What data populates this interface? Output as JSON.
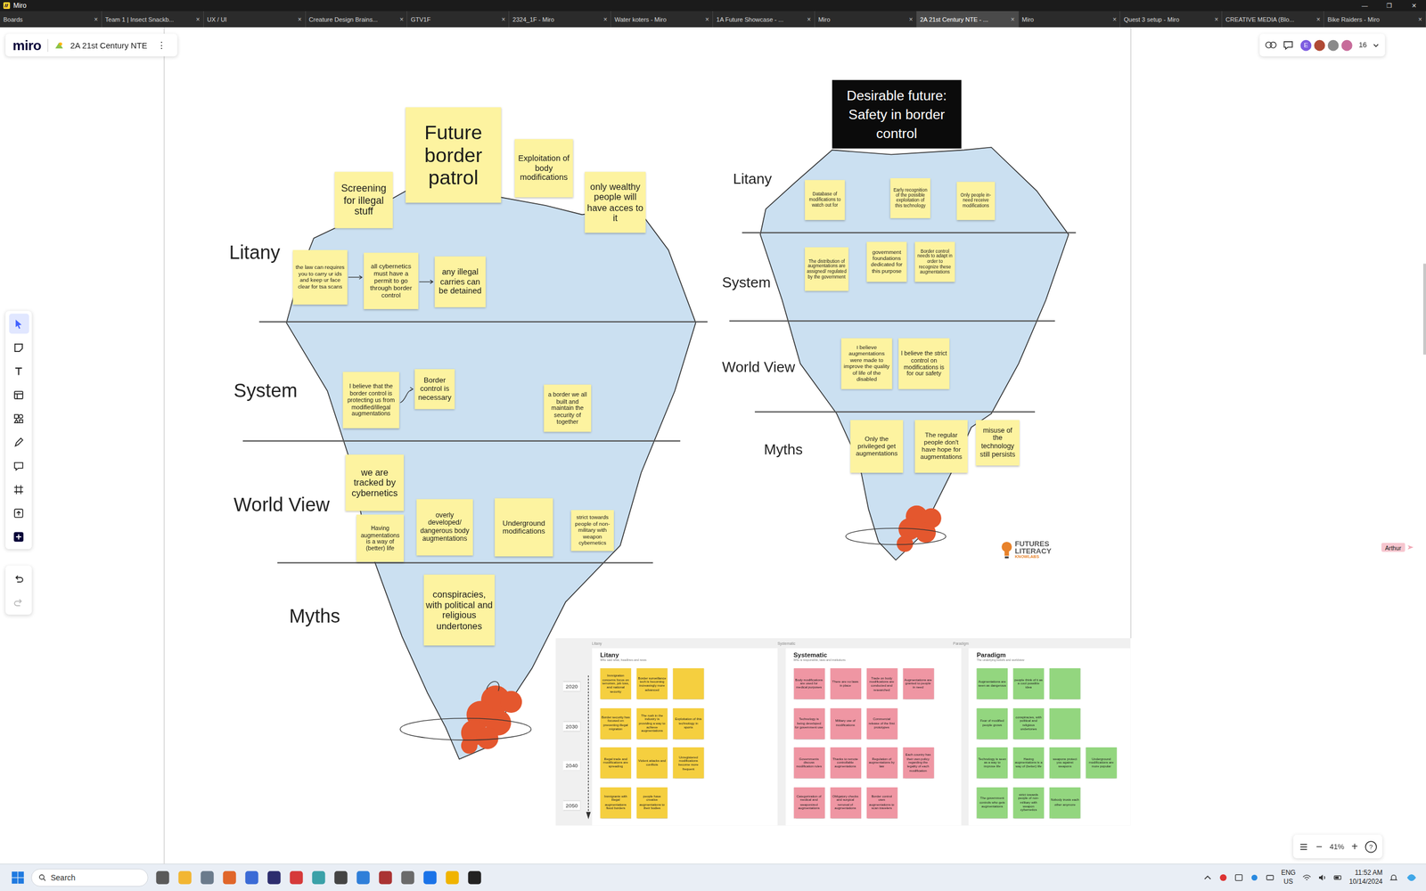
{
  "window": {
    "title": "Miro",
    "controls": [
      "—",
      "❐",
      "✕"
    ]
  },
  "tabs": [
    {
      "label": "Boards",
      "selected": false
    },
    {
      "label": "Team 1 | Insect Snackb...",
      "selected": false
    },
    {
      "label": "UX / UI",
      "selected": false
    },
    {
      "label": "Creature Design Brains...",
      "selected": false
    },
    {
      "label": "GTV1F",
      "selected": false
    },
    {
      "label": "2324_1F - Miro",
      "selected": false
    },
    {
      "label": "Water koters - Miro",
      "selected": false
    },
    {
      "label": "1A Future Showcase - ...",
      "selected": false
    },
    {
      "label": "Miro",
      "selected": false
    },
    {
      "label": "2A 21st Century NTE - ...",
      "selected": true
    },
    {
      "label": "Miro",
      "selected": false
    },
    {
      "label": "Quest 3 setup - Miro",
      "selected": false
    },
    {
      "label": "CREATIVE MEDIA (Blo...",
      "selected": false
    },
    {
      "label": "Bike Raiders - Miro",
      "selected": false
    }
  ],
  "tab_close": "×",
  "board": {
    "logo": "miro",
    "name": "2A 21st Century NTE",
    "menu": "⋮",
    "collaborator_count": "16",
    "avatars": [
      {
        "initial": "E",
        "color": "#7c5ce0"
      },
      {
        "initial": "",
        "color": "#b04a35"
      },
      {
        "initial": "",
        "color": "#8a8a8a"
      },
      {
        "initial": "",
        "color": "#c76b9a"
      }
    ]
  },
  "toolbar": {
    "tools": [
      {
        "kind": "select",
        "selected": true
      },
      {
        "kind": "sticky",
        "selected": false
      },
      {
        "kind": "text",
        "selected": false
      },
      {
        "kind": "table",
        "selected": false
      },
      {
        "kind": "shapes",
        "selected": false
      },
      {
        "kind": "pen",
        "selected": false
      },
      {
        "kind": "comment",
        "selected": false
      },
      {
        "kind": "frame",
        "selected": false
      },
      {
        "kind": "upload",
        "selected": false
      },
      {
        "kind": "more",
        "selected": false
      }
    ],
    "history": [
      {
        "kind": "undo",
        "disabled": false
      },
      {
        "kind": "redo",
        "disabled": true
      }
    ]
  },
  "zoom": {
    "level": "41%",
    "minus": "−",
    "plus": "+",
    "help": "?"
  },
  "cursor_label": "Arthur",
  "left_iceberg": {
    "layers": [
      "Litany",
      "System",
      "World View",
      "Myths"
    ],
    "notes": [
      {
        "text": "Future border patrol"
      },
      {
        "text": "Screening for illegal stuff"
      },
      {
        "text": "Exploitation of body modifications"
      },
      {
        "text": "only wealthy people will have acces to it"
      },
      {
        "text": "the law can requires you to carry ur ids and keep ur face clear for tsa scans"
      },
      {
        "text": "all cybernetics must have a permit to go through border control"
      },
      {
        "text": "any illegal carries can be detained"
      },
      {
        "text": "I believe that the border control is protecting us from modified/illegal augmentations"
      },
      {
        "text": "Border control is necessary"
      },
      {
        "text": "a border we all built and maintain the security of together"
      },
      {
        "text": "we are tracked by cybernetics"
      },
      {
        "text": "Having augmentations is a way of (better) life"
      },
      {
        "text": "overly developed/ dangerous body augmentations"
      },
      {
        "text": "Underground modifications"
      },
      {
        "text": "strict towards people of non-military with weapon cybernetics"
      },
      {
        "text": "conspiracies, with political and religious undertones"
      }
    ]
  },
  "right_iceberg": {
    "title": "Desirable future: Safety in border control",
    "layers": [
      "Litany",
      "System",
      "World View",
      "Myths"
    ],
    "notes": [
      {
        "text": "Database of modifications to watch out for"
      },
      {
        "text": "Early recognition of the possible exploitation of this technology"
      },
      {
        "text": "Only people in-need receive modifications"
      },
      {
        "text": "The distribution of augmentations are assigned/ regulated by the government"
      },
      {
        "text": "government foundations dedicated for this purpose"
      },
      {
        "text": "Border control needs to adapt in order to recognize these augmentations"
      },
      {
        "text": "I believe augmentations were made to improve the quality of life of the disabled"
      },
      {
        "text": "I believe the strict control on modifications is for our safety"
      },
      {
        "text": "Only the privileged get augmentations"
      },
      {
        "text": "The regular people don't have hope for augmentations"
      },
      {
        "text": "misuse of the technology still persists"
      }
    ]
  },
  "logo": {
    "line1": "FUTURES",
    "line2": "LITERACY",
    "line3": "KNOWLABS"
  },
  "timeline_table": {
    "years": [
      "2020",
      "2030",
      "2040",
      "2050"
    ],
    "panels": [
      {
        "label": "Litany",
        "title": "Litany",
        "subtitle": "Who said what, headlines and news",
        "color": "#f5cf3f",
        "rows": [
          [
            "Immigration concerns focus on terrorism, job loss, and national security",
            "Border surveillance tech is becoming increasingly more advanced",
            ""
          ],
          [
            "Border security has focused on preventing illegal migration",
            "The rush in the industry is providing a way to achieve augmentations",
            "Exploitation of this technology in sports"
          ],
          [
            "Illegal trade and modifications are spreading",
            "Violent attacks and conflicts",
            "Unregistered modifications become more frequent"
          ],
          [
            "Immigrants with illegal augmentations flood borders",
            "people have creative augmentations to their bodies"
          ]
        ]
      },
      {
        "label": "Systematic",
        "title": "Systematic",
        "subtitle": "Who is responsible, laws and institutions",
        "color": "#ef96a3",
        "rows": [
          [
            "Body modifications are used for medical purposes",
            "There are no laws in place",
            "Trade on body modifications are conducted and researched",
            "Augmentations are granted to people in need"
          ],
          [
            "Technology is being developed for government use",
            "Military use of modifications",
            "Commercial release of the first prototypes"
          ],
          [
            "Governments discuss modification rules",
            "Thanks to remote controllable augmentations",
            "Regulation of augmentations by law",
            "Each country has their own policy regarding the legality of each modification"
          ],
          [
            "Categorization of medical and weaponized augmentations",
            "Obligatory checks and surgical removal of augmentations",
            "Border control uses augmentations to scan travelers"
          ]
        ]
      },
      {
        "label": "Paradigm",
        "title": "Paradigm",
        "subtitle": "The underlying beliefs and worldview",
        "color": "#93d67f",
        "rows": [
          [
            "Augmentations are seen as dangerous",
            "people think of it as a cool possible idea",
            ""
          ],
          [
            "Fear of modified people grows",
            "conspiracies, with political and religious undertones",
            ""
          ],
          [
            "Technology is seen as a way to improve life",
            "Having augmentations is a way of (better) life",
            "weapons protect you against weapons",
            "Underground modifications are more popular"
          ],
          [
            "The government controls who gets augmentations",
            "strict towards people of non-military with weapon cybernetics",
            "Nobody trusts each other anymore"
          ]
        ]
      }
    ]
  },
  "taskbar": {
    "search_placeholder": "Search",
    "language": "ENG",
    "region": "US",
    "time": "11:52 AM",
    "date": "10/14/2024"
  }
}
